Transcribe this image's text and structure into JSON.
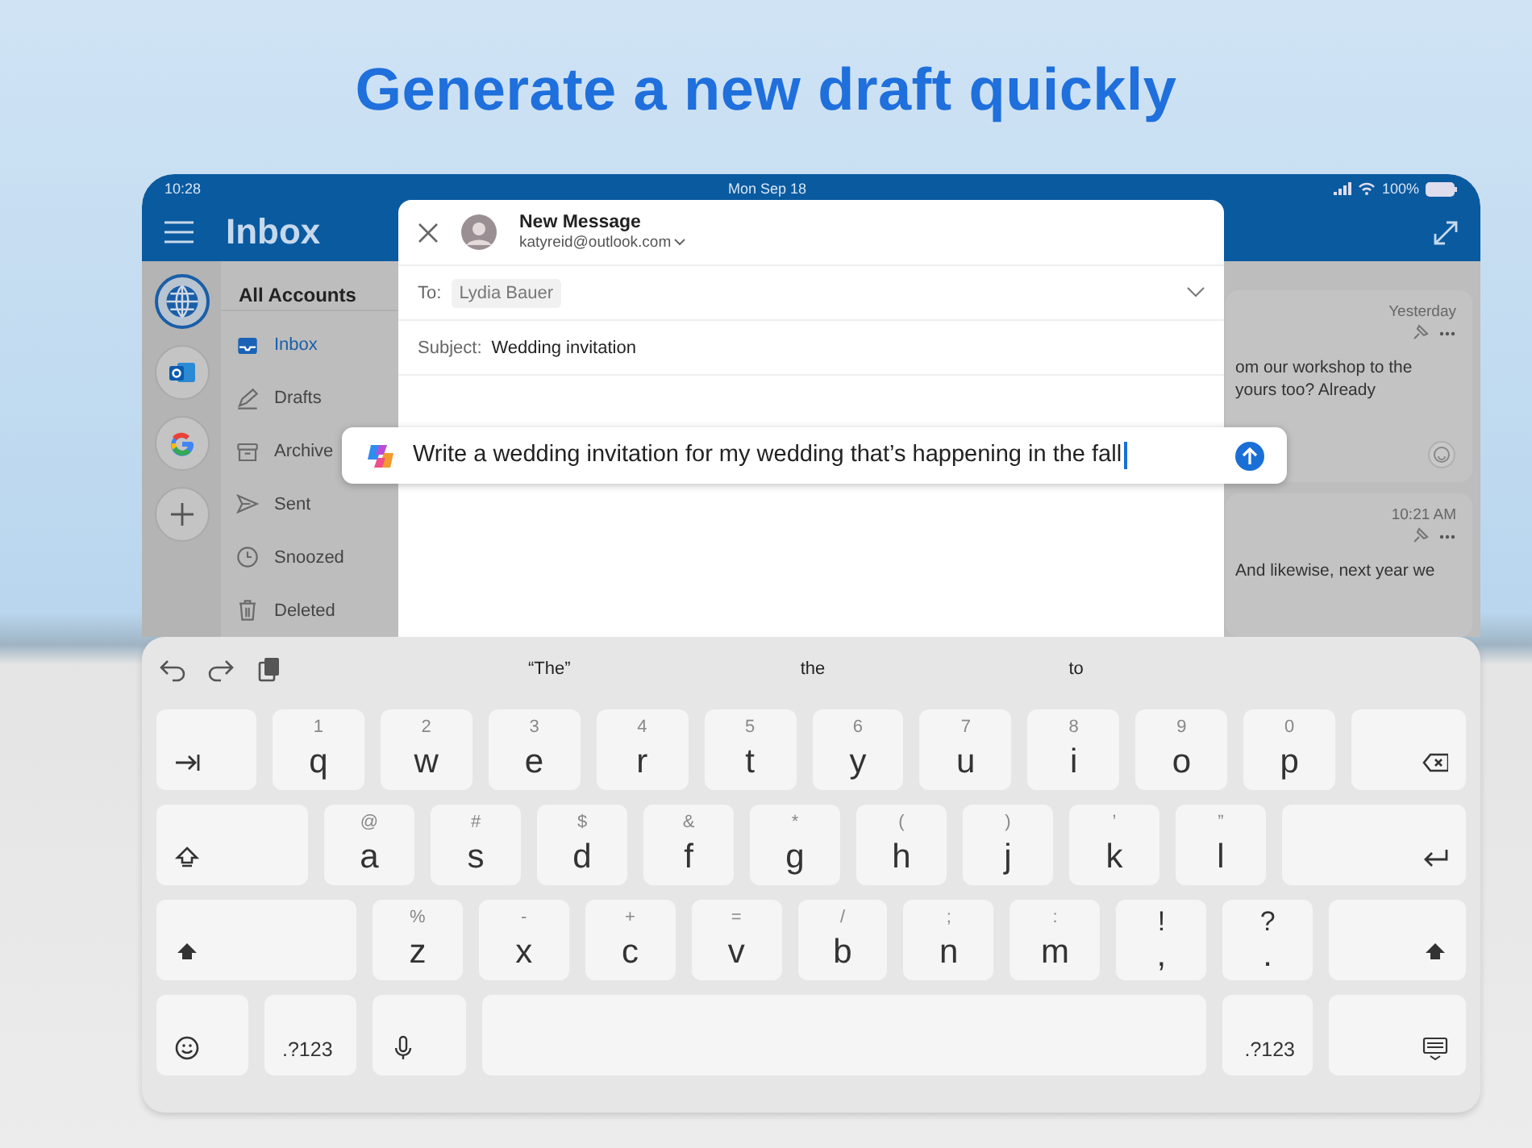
{
  "headline": "Generate a new draft quickly",
  "status_bar": {
    "time": "10:28",
    "date": "Mon Sep 18",
    "battery": "100%"
  },
  "header": {
    "title": "Inbox"
  },
  "accounts": [
    {
      "kind": "all",
      "selected": true
    },
    {
      "kind": "outlook",
      "selected": false
    },
    {
      "kind": "google",
      "selected": false
    },
    {
      "kind": "add",
      "selected": false
    }
  ],
  "folders": {
    "heading": "All Accounts",
    "items": [
      {
        "label": "Inbox",
        "kind": "inbox",
        "selected": true
      },
      {
        "label": "Drafts",
        "kind": "drafts",
        "selected": false
      },
      {
        "label": "Archive",
        "kind": "archive",
        "selected": false
      },
      {
        "label": "Sent",
        "kind": "sent",
        "selected": false
      },
      {
        "label": "Snoozed",
        "kind": "snoozed",
        "selected": false
      },
      {
        "label": "Deleted",
        "kind": "deleted",
        "selected": false
      }
    ]
  },
  "messages": [
    {
      "time": "Yesterday",
      "lines": [
        "om our workshop to the",
        "yours too? Already"
      ]
    },
    {
      "time": "10:21 AM",
      "lines": [
        "And likewise, next year we"
      ]
    }
  ],
  "compose": {
    "title": "New Message",
    "account": "katyreid@outlook.com",
    "to_label": "To:",
    "recipient": "Lydia Bauer",
    "subject_label": "Subject:",
    "subject": "Wedding invitation"
  },
  "prompt": {
    "text": "Write a wedding invitation for my wedding that’s happening in the fall"
  },
  "keyboard": {
    "suggestions": [
      "“The”",
      "the",
      "to"
    ],
    "rows": [
      {
        "keys": [
          {
            "kind": "tab"
          },
          {
            "kind": "letter",
            "label": "q",
            "hint": "1"
          },
          {
            "kind": "letter",
            "label": "w",
            "hint": "2"
          },
          {
            "kind": "letter",
            "label": "e",
            "hint": "3"
          },
          {
            "kind": "letter",
            "label": "r",
            "hint": "4"
          },
          {
            "kind": "letter",
            "label": "t",
            "hint": "5"
          },
          {
            "kind": "letter",
            "label": "y",
            "hint": "6"
          },
          {
            "kind": "letter",
            "label": "u",
            "hint": "7"
          },
          {
            "kind": "letter",
            "label": "i",
            "hint": "8"
          },
          {
            "kind": "letter",
            "label": "o",
            "hint": "9"
          },
          {
            "kind": "letter",
            "label": "p",
            "hint": "0"
          },
          {
            "kind": "backspace"
          }
        ]
      },
      {
        "keys": [
          {
            "kind": "caps"
          },
          {
            "kind": "letter",
            "label": "a",
            "hint": "@"
          },
          {
            "kind": "letter",
            "label": "s",
            "hint": "#"
          },
          {
            "kind": "letter",
            "label": "d",
            "hint": "$"
          },
          {
            "kind": "letter",
            "label": "f",
            "hint": "&"
          },
          {
            "kind": "letter",
            "label": "g",
            "hint": "*"
          },
          {
            "kind": "letter",
            "label": "h",
            "hint": "("
          },
          {
            "kind": "letter",
            "label": "j",
            "hint": ")"
          },
          {
            "kind": "letter",
            "label": "k",
            "hint": "’"
          },
          {
            "kind": "letter",
            "label": "l",
            "hint": "”"
          },
          {
            "kind": "return"
          }
        ]
      },
      {
        "keys": [
          {
            "kind": "shift"
          },
          {
            "kind": "letter",
            "label": "z",
            "hint": "%"
          },
          {
            "kind": "letter",
            "label": "x",
            "hint": "-"
          },
          {
            "kind": "letter",
            "label": "c",
            "hint": "+"
          },
          {
            "kind": "letter",
            "label": "v",
            "hint": "="
          },
          {
            "kind": "letter",
            "label": "b",
            "hint": "/"
          },
          {
            "kind": "letter",
            "label": "n",
            "hint": ";"
          },
          {
            "kind": "letter",
            "label": "m",
            "hint": ":"
          },
          {
            "kind": "punct",
            "label": ",",
            "hint": "!"
          },
          {
            "kind": "punct",
            "label": ".",
            "hint": "?"
          },
          {
            "kind": "shift"
          }
        ]
      },
      {
        "keys": [
          {
            "kind": "emoji"
          },
          {
            "kind": "numbers",
            "label": ".?123"
          },
          {
            "kind": "mic"
          },
          {
            "kind": "space"
          },
          {
            "kind": "numbers",
            "label": ".?123"
          },
          {
            "kind": "hide"
          }
        ]
      }
    ]
  }
}
